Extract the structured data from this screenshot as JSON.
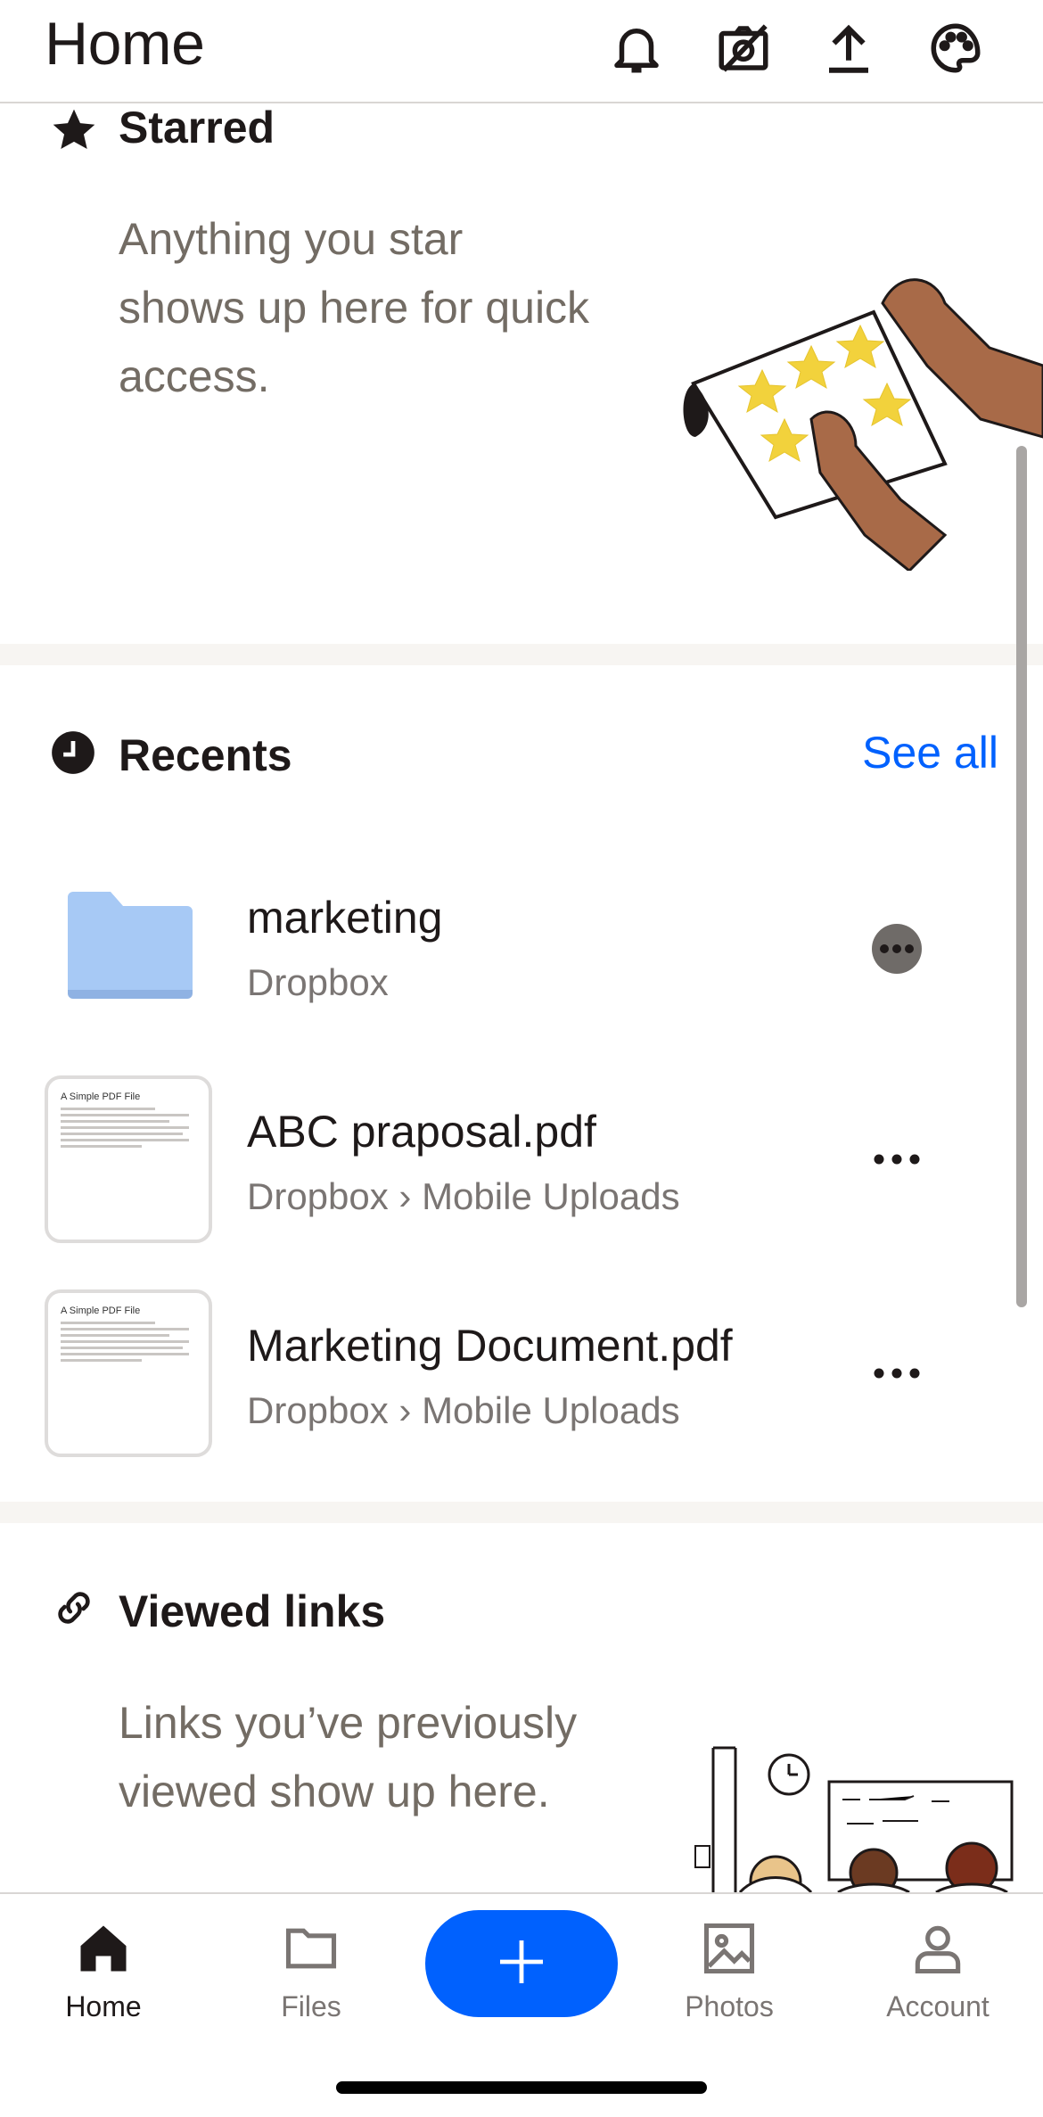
{
  "header": {
    "title": "Home",
    "icons": [
      "bell-icon",
      "camera-off-icon",
      "upload-icon",
      "palette-icon"
    ]
  },
  "starred": {
    "title": "Starred",
    "description_lines": [
      "Anything you star",
      "shows up here for quick",
      "access."
    ]
  },
  "recents": {
    "title": "Recents",
    "see_all": "See all",
    "items": [
      {
        "name": "marketing",
        "path": "Dropbox",
        "kind": "folder"
      },
      {
        "name": "ABC praposal.pdf",
        "path": "Dropbox › Mobile Uploads",
        "kind": "pdf",
        "thumb_title": "A Simple PDF File"
      },
      {
        "name": "Marketing Document.pdf",
        "path": "Dropbox › Mobile Uploads",
        "kind": "pdf",
        "thumb_title": "A Simple PDF File"
      }
    ]
  },
  "viewed_links": {
    "title": "Viewed links",
    "description_lines": [
      "Links you’ve previously",
      "viewed show up here."
    ]
  },
  "nav": {
    "items": [
      {
        "label": "Home",
        "active": true
      },
      {
        "label": "Files",
        "active": false
      },
      {
        "label": "Photos",
        "active": false
      },
      {
        "label": "Account",
        "active": false
      }
    ]
  },
  "colors": {
    "accent": "#0061fe",
    "folder": "#a7c9f5",
    "star": "#f2d23c",
    "skin": "#a86a48"
  }
}
